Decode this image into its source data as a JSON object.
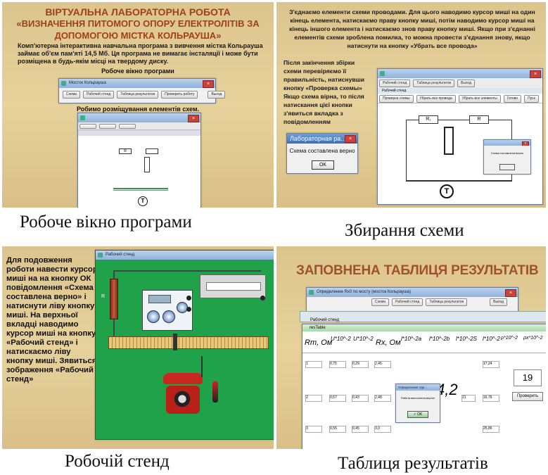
{
  "panels": {
    "p1": {
      "title_line1": "ВІРТУАЛЬНА ЛАБОРАТОРНА РОБОТА",
      "title_line2": "«ВИЗНАЧЕННЯ ПИТОМОГО ОПОРУ ЕЛЕКТРОЛІТІВ ЗА",
      "title_line3": "ДОПОМОГОЮ МІСТКА КОЛЬРАУША»",
      "desc": "Комп'ютерна інтерактивна навчальна програма з вивчення містка Кольрауша займає об'єм пам'яті 14,5 Мб. Ця програма не вимагає інсталяції і може бути розміщена в будь-якім місці на твердому диску.",
      "label_window": "Робоче  вікно програми",
      "label_placement": "Робимо розміщування елементів схем.",
      "mini_title": "Мосток Кольрауша",
      "mini_buttons": [
        "Схема",
        "Рабочий стенд",
        "Таблица результатов",
        "Проверить работу"
      ],
      "mini_exit": "Выход",
      "scheme_letter": "T",
      "res_label": "R"
    },
    "p2": {
      "top_text": "З'єднаємо елементи схеми проводами. Для цього наводимо курсор миші на один кінець елемента,  натискаємо праву кнопку миші, потім наводимо курсор миші на кінець іншого елемента і натискаємо знов праву кнопку миші. Якщо при з'єднанні елементів схеми зроблена помилка, то можна провести з'єднання знову, якщо натиснути на кнопку «Убрать все провода»",
      "side_text": "Після закінчення збірки схеми перевіряємо її правильність, натиснувши кнопку «Проверка схемы» Якщо схема вірна, то після натискання цієї кнопки з'явиться вкладка з повідомленням",
      "dialog_title": "Лабораторная ра...",
      "dialog_message": "Схема составлена верно",
      "dialog_ok": "OK",
      "win_buttons": [
        "Рабочий стенд",
        "Таблица результатов",
        "Выход"
      ],
      "win_tab": "Рабочий стенд",
      "toolbar_items": [
        "Проверка схемы",
        "Убрать все провода",
        "Убрать все элементы",
        "Готово",
        "Пуск"
      ],
      "r1_label": "R₁",
      "r2_label": "R",
      "scheme_letter": "T",
      "small_dialog_msg": "Схема составлена верно"
    },
    "p3": {
      "text": "Для подовження роботи навести курсор миші на на кнопку ОК повідомлення «Схема составлена верно» і натиснути ліву кнопку миші. На верхньої вкладці наводимо курсор миші на кнопку «Рабочий стенд» і натискаємо ліву кнопку миші. Зявиться зображення «Рабочий стенд»",
      "win_title": "Рабочий стенд",
      "res_label": "R"
    },
    "p4": {
      "title": "ЗАПОВНЕНА ТАБЛИЦЯ РЕЗУЛЬТАТІВ",
      "win_title": "Определение Rx0 по мосту (мосток Кольрауша)",
      "win_buttons": [
        "Схема",
        "Рабочий стенд",
        "Таблица результатов",
        "Выход"
      ],
      "tab_label": "Рабочий стенд",
      "grid_title": "resTable",
      "headers": [
        "Rm, Ом",
        "U*10^-2",
        "U*10^-2",
        "Rx, Ом",
        "l*10^-2а",
        "l*10^-2b",
        "l*10^-2S",
        "l*10^-2",
        "ρ*10^-2",
        "ρx*10^-2"
      ],
      "rows": [
        {
          "n": "1",
          "u1": "0,75",
          "u2": "0,29",
          "rx": "2,45",
          "rho": "17,24"
        },
        {
          "n": "2",
          "u1": "0,57",
          "u2": "0,43",
          "rx": "2,48",
          "rho": "16,76"
        },
        {
          "n": "3",
          "u1": "0,55",
          "u2": "0,45",
          "rx": "3,0",
          "rho": "25,86"
        }
      ],
      "big_value": "4,2",
      "mid_value": "21",
      "answer": "19",
      "check_button": "Проверить",
      "dialog_title": "Определение Удe...",
      "dialog_msg": "Работа выполнена верно!",
      "dialog_ok": "OK"
    }
  },
  "captions": {
    "c1": "Робоче вікно програми",
    "c2": "Збирання схеми",
    "c3": "Робочій стенд",
    "c4": "Таблиця результатів"
  }
}
